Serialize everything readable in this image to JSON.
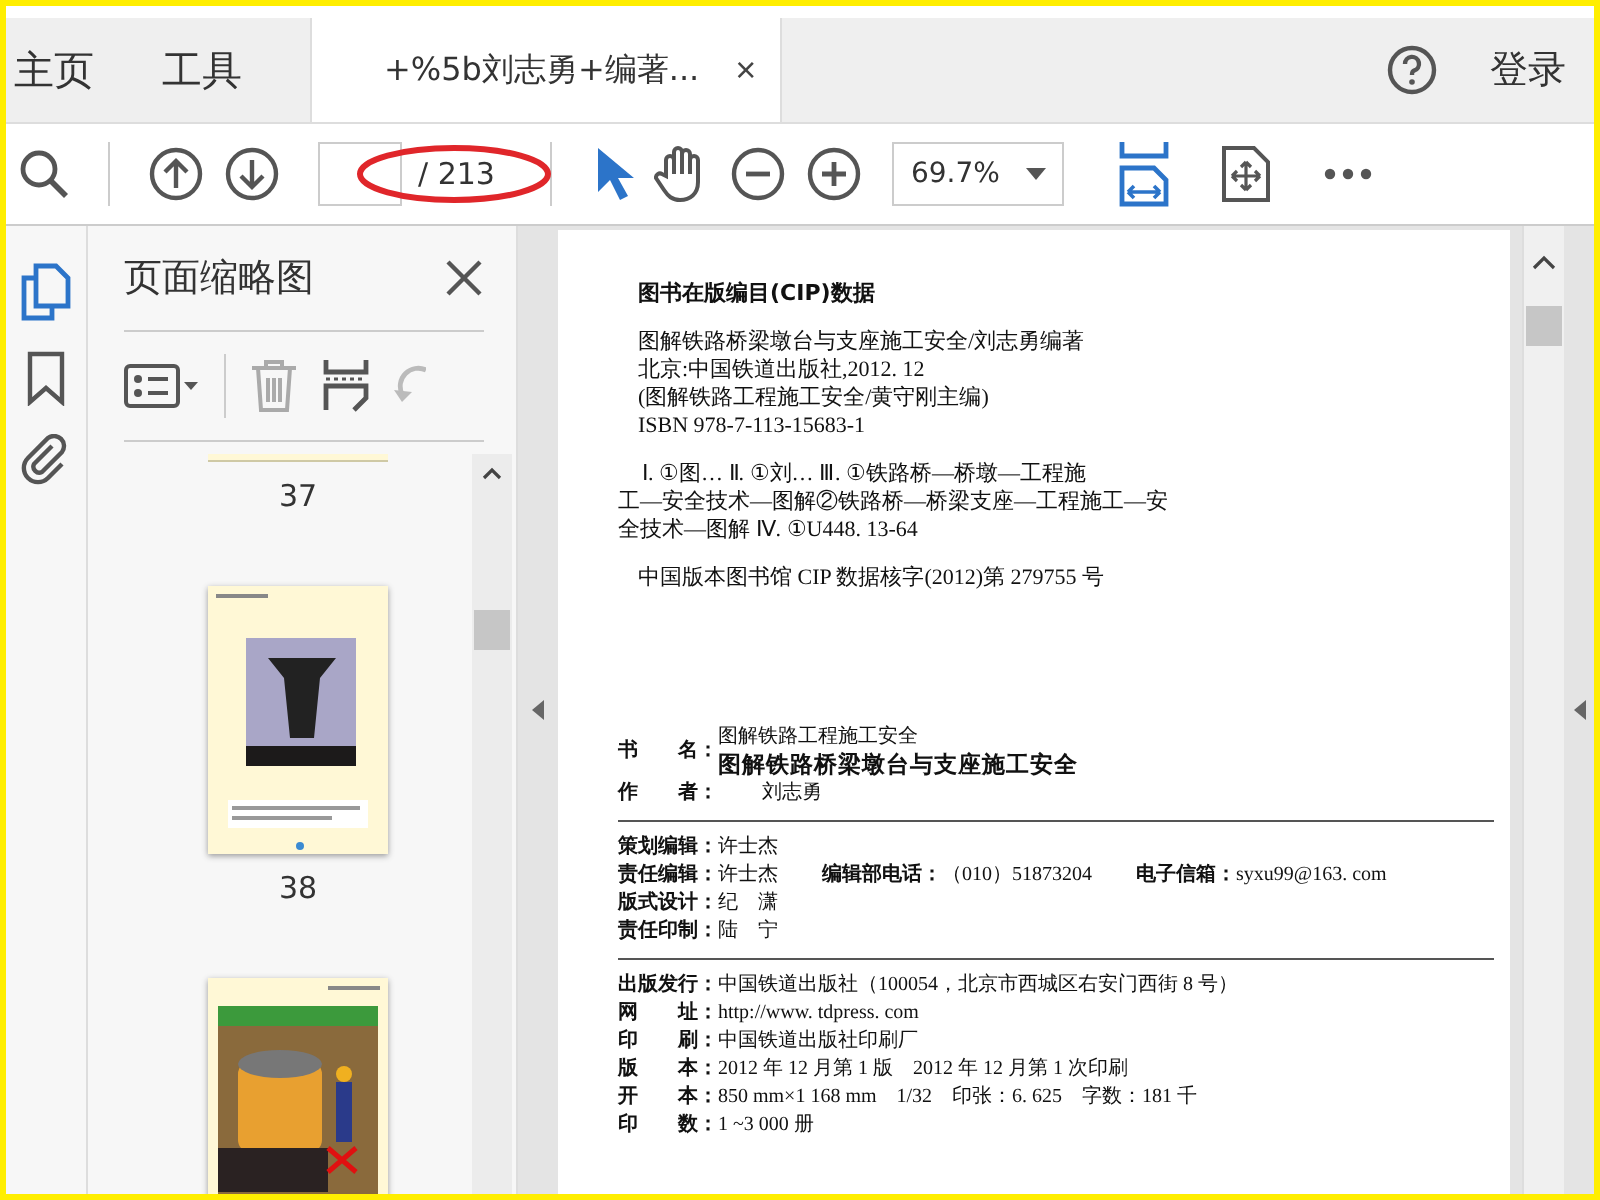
{
  "tabs": [
    {
      "label": "主页",
      "selected": false
    },
    {
      "label": "工具",
      "selected": false
    },
    {
      "label": "+%5b刘志勇+编著...",
      "selected": true,
      "close": "×"
    }
  ],
  "sign_in": "登录",
  "toolbar": {
    "page_count": "/ 213",
    "zoom": "69.7%"
  },
  "sidebar": {
    "title": "页面缩略图",
    "thumbnails": [
      {
        "kind": "edge",
        "label": "37"
      },
      {
        "kind": "tower",
        "label": "38"
      },
      {
        "kind": "worker"
      }
    ]
  },
  "document": {
    "cip_heading": "图书在版编目(CIP)数据",
    "cip_lines": [
      "图解铁路桥梁墩台与支座施工安全/刘志勇编著",
      "北京:中国铁道出版社,2012. 12",
      "(图解铁路工程施工安全/黄守刚主编)",
      "ISBN 978-7-113-15683-1"
    ],
    "classification": [
      "Ⅰ. ①图… Ⅱ. ①刘… Ⅲ. ①铁路桥—桥墩—工程施",
      "工—安全技术—图解②铁路桥—桥梁支座—工程施工—安",
      "全技术—图解 Ⅳ. ①U448. 13-64"
    ],
    "cip_number": "中国版本图书馆 CIP 数据核字(2012)第 279755 号",
    "title_label": "书　　名：",
    "series": "图解铁路工程施工安全",
    "title": "图解铁路桥梁墩台与支座施工安全",
    "author_label": "作　　者：",
    "author": "刘志勇",
    "sections": [
      [
        {
          "fields": [
            {
              "label": "策划编辑：",
              "value": "许士杰"
            }
          ]
        },
        {
          "fields": [
            {
              "label": "责任编辑：",
              "value": "许士杰"
            },
            {
              "label": "编辑部电话：",
              "value": "（010）51873204"
            },
            {
              "label": "电子信箱：",
              "value": "syxu99@163. com"
            }
          ]
        },
        {
          "fields": [
            {
              "label": "版式设计：",
              "value": "纪　潇"
            }
          ]
        },
        {
          "fields": [
            {
              "label": "责任印制：",
              "value": "陆　宁"
            }
          ]
        }
      ],
      [
        {
          "fields": [
            {
              "label": "出版发行：",
              "value": "中国铁道出版社（100054，北京市西城区右安门西街 8 号）"
            }
          ]
        },
        {
          "fields": [
            {
              "label": "网　　址：",
              "value": "http://www. tdpress. com"
            }
          ]
        },
        {
          "fields": [
            {
              "label": "印　　刷：",
              "value": "中国铁道出版社印刷厂"
            }
          ]
        },
        {
          "fields": [
            {
              "label": "版　　本：",
              "value": "2012 年 12 月第 1 版　2012 年 12 月第 1 次印刷"
            }
          ]
        },
        {
          "fields": [
            {
              "label": "开　　本：",
              "value": "850 mm×1 168 mm　1/32　印张：6. 625　字数：181 千"
            }
          ]
        },
        {
          "fields": [
            {
              "label": "印　　数：",
              "value": "1 ~3 000 册"
            }
          ]
        }
      ]
    ]
  }
}
